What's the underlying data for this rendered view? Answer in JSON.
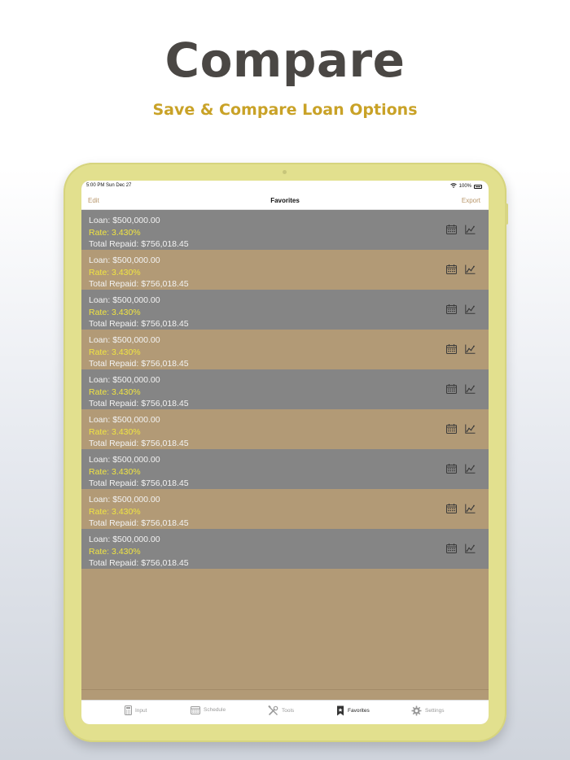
{
  "promo": {
    "headline": "Compare",
    "subheadline": "Save & Compare Loan Options"
  },
  "status_bar": {
    "time": "5:00 PM  Sun Dec 27",
    "battery": "100%"
  },
  "nav": {
    "edit": "Edit",
    "title": "Favorites",
    "export": "Export"
  },
  "favorites": [
    {
      "loan": "Loan: $500,000.00",
      "rate": "Rate: 3.430%",
      "total": "Total Repaid: $756,018.45"
    },
    {
      "loan": "Loan: $500,000.00",
      "rate": "Rate: 3.430%",
      "total": "Total Repaid: $756,018.45"
    },
    {
      "loan": "Loan: $500,000.00",
      "rate": "Rate: 3.430%",
      "total": "Total Repaid: $756,018.45"
    },
    {
      "loan": "Loan: $500,000.00",
      "rate": "Rate: 3.430%",
      "total": "Total Repaid: $756,018.45"
    },
    {
      "loan": "Loan: $500,000.00",
      "rate": "Rate: 3.430%",
      "total": "Total Repaid: $756,018.45"
    },
    {
      "loan": "Loan: $500,000.00",
      "rate": "Rate: 3.430%",
      "total": "Total Repaid: $756,018.45"
    },
    {
      "loan": "Loan: $500,000.00",
      "rate": "Rate: 3.430%",
      "total": "Total Repaid: $756,018.45"
    },
    {
      "loan": "Loan: $500,000.00",
      "rate": "Rate: 3.430%",
      "total": "Total Repaid: $756,018.45"
    },
    {
      "loan": "Loan: $500,000.00",
      "rate": "Rate: 3.430%",
      "total": "Total Repaid: $756,018.45"
    }
  ],
  "row_icons": [
    "calendar-icon",
    "chart-icon"
  ],
  "tabs": [
    {
      "label": "Input",
      "icon": "calculator-icon"
    },
    {
      "label": "Schedule",
      "icon": "calendar-icon"
    },
    {
      "label": "Tools",
      "icon": "tools-icon"
    },
    {
      "label": "Favorites",
      "icon": "bookmark-icon",
      "active": true
    },
    {
      "label": "Settings",
      "icon": "gear-icon"
    }
  ],
  "colors": {
    "headline": "#4a4744",
    "subheadline": "#c9a227",
    "device": "#e2e08e",
    "row_gray": "#858585",
    "row_tan": "#b29a76",
    "rate_text": "#f0e442",
    "nav_accent": "#b8966a"
  }
}
